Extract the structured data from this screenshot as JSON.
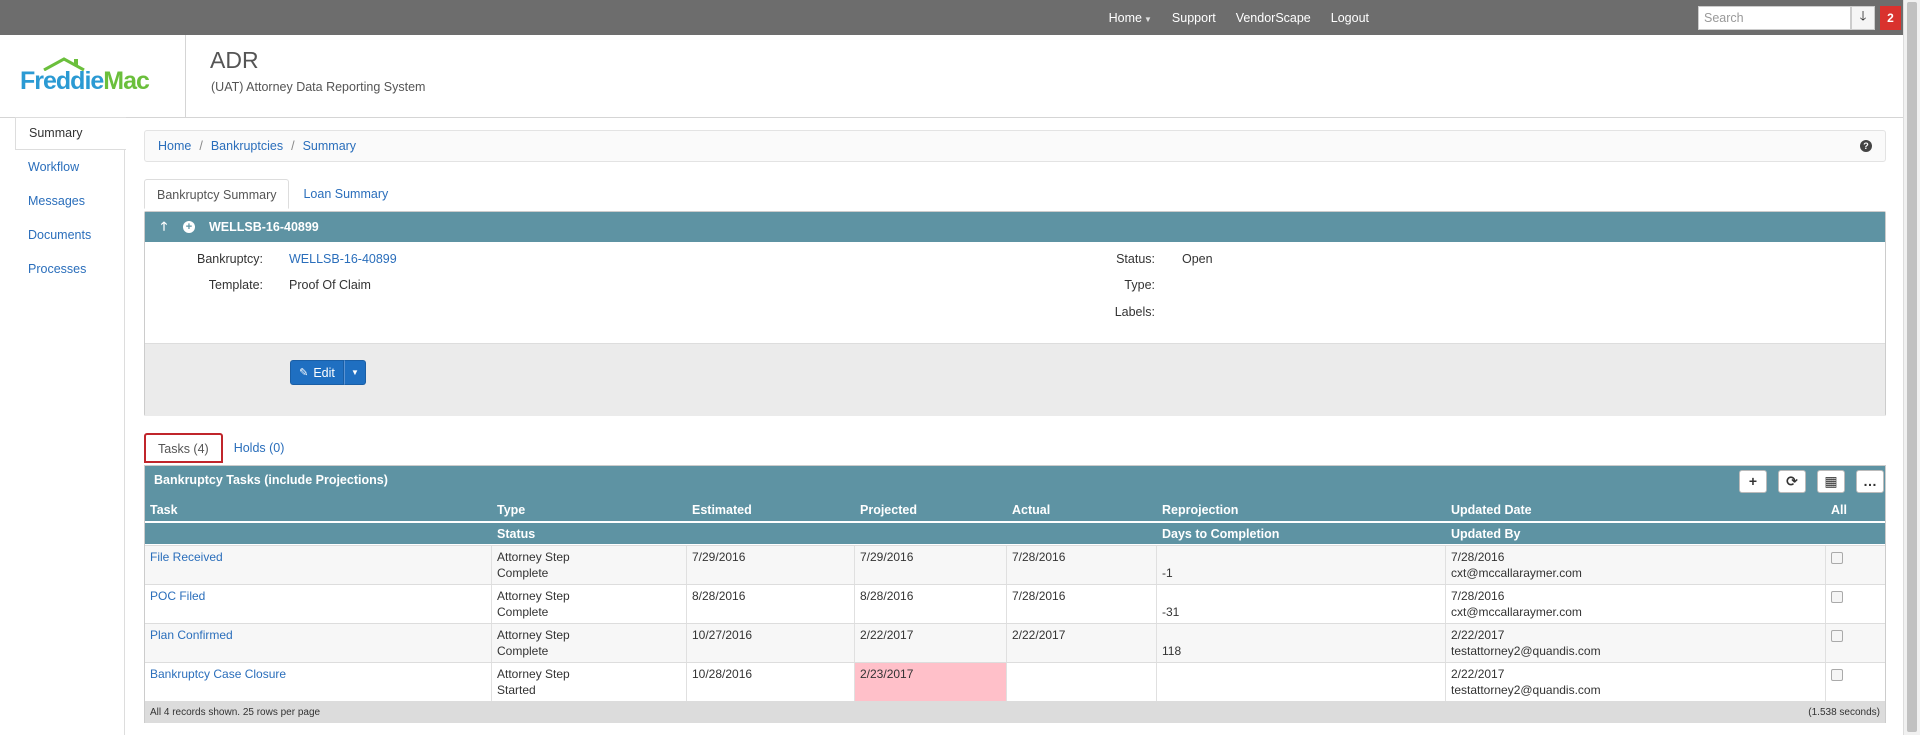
{
  "topnav": {
    "home": "Home",
    "support": "Support",
    "vendorscape": "VendorScape",
    "logout": "Logout",
    "search_placeholder": "Search",
    "notification_count": "2"
  },
  "header": {
    "logo_freddie": "Freddie",
    "logo_mac": "Mac",
    "title": "ADR",
    "subtitle": "(UAT) Attorney Data Reporting System"
  },
  "sidebar": {
    "items": [
      "Summary",
      "Workflow",
      "Messages",
      "Documents",
      "Processes"
    ]
  },
  "breadcrumb": {
    "items": [
      "Home",
      "Bankruptcies",
      "Summary"
    ]
  },
  "detail_tabs": [
    "Bankruptcy Summary",
    "Loan Summary"
  ],
  "bankruptcy": {
    "id": "WELLSB-16-40899",
    "bankruptcy_label": "Bankruptcy:",
    "bankruptcy_value": "WELLSB-16-40899",
    "template_label": "Template:",
    "template_value": "Proof Of Claim",
    "status_label": "Status:",
    "status_value": "Open",
    "type_label": "Type:",
    "type_value": "",
    "labels_label": "Labels:",
    "labels_value": "",
    "edit_label": "Edit"
  },
  "task_tabs": [
    "Tasks (4)",
    "Holds (0)"
  ],
  "tasks": {
    "title": "Bankruptcy Tasks (include Projections)",
    "columns": {
      "task": "Task",
      "type": "Type",
      "status": "Status",
      "estimated": "Estimated",
      "projected": "Projected",
      "actual": "Actual",
      "reprojection": "Reprojection",
      "days": "Days to Completion",
      "updated_date": "Updated Date",
      "updated_by": "Updated By",
      "all": "All"
    },
    "rows": [
      {
        "task": "File Received",
        "type": "Attorney Step",
        "status": "Complete",
        "estimated": "7/29/2016",
        "projected": "7/29/2016",
        "actual": "7/28/2016",
        "days": "-1",
        "updated_date": "7/28/2016",
        "updated_by": "cxt@mccallaraymer.com"
      },
      {
        "task": "POC Filed",
        "type": "Attorney Step",
        "status": "Complete",
        "estimated": "8/28/2016",
        "projected": "8/28/2016",
        "actual": "7/28/2016",
        "days": "-31",
        "updated_date": "7/28/2016",
        "updated_by": "cxt@mccallaraymer.com"
      },
      {
        "task": "Plan Confirmed",
        "type": "Attorney Step",
        "status": "Complete",
        "estimated": "10/27/2016",
        "projected": "2/22/2017",
        "actual": "2/22/2017",
        "days": "118",
        "updated_date": "2/22/2017",
        "updated_by": "testattorney2@quandis.com"
      },
      {
        "task": "Bankruptcy Case Closure",
        "type": "Attorney Step",
        "status": "Started",
        "estimated": "10/28/2016",
        "projected": "2/23/2017",
        "actual": "",
        "days": "",
        "updated_date": "2/22/2017",
        "updated_by": "testattorney2@quandis.com"
      }
    ],
    "footer_left": "All 4 records shown. 25 rows per page",
    "footer_right": "(1.538 seconds)"
  },
  "colors": {
    "topbar": "#6d6d6d",
    "panel_header": "#5e93a3",
    "link": "#2a6ebb",
    "overdue": "#ffc0c9",
    "badge": "#d9322e"
  }
}
